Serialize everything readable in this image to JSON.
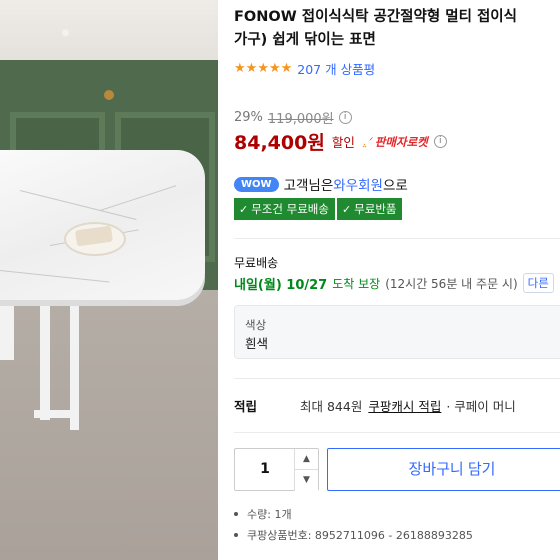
{
  "product": {
    "title_line1": "FONOW 접이식식탁 공간절약형 멀티 접이식",
    "title_line2": "가구) 쉽게 닦이는 표면",
    "rating_stars": 5,
    "review_count": "207 개 상품평"
  },
  "pricing": {
    "discount_rate": "29%",
    "original_price": "119,000원",
    "sale_price": "84,400원",
    "sale_label": "할인",
    "rocket_label": "판매자로켓",
    "info_icon": "ⓘ"
  },
  "wow": {
    "badge": "WOW",
    "prefix": "고객님은",
    "member": "와우회원",
    "suffix": "으로"
  },
  "benefits": [
    "무조건 무료배송",
    "무료반품"
  ],
  "shipping": {
    "label": "무료배송",
    "date": "내일(월) 10/27",
    "guarantee": "도착 보장",
    "cutoff": "(12시간 56분 내 주문 시)",
    "other": "다른"
  },
  "option": {
    "label": "색상",
    "value": "흰색"
  },
  "reward": {
    "title": "적립",
    "text": "최대 844원",
    "link": "쿠팡캐시 적립",
    "extra": "· 쿠페이 머니"
  },
  "purchase": {
    "quantity": "1",
    "cart_button": "장바구니 담기"
  },
  "specs": [
    "수량: 1개",
    "쿠팡상품번호: 8952711096 - 26188893285"
  ],
  "colors": {
    "price_red": "#ae0000",
    "link_blue": "#346aff",
    "benefit_green": "#1f8a2f",
    "star_orange": "#f7941d"
  }
}
